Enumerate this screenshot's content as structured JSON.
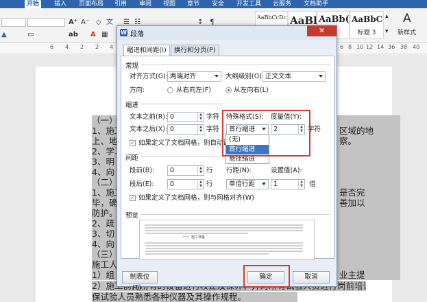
{
  "menubar": {
    "items": [
      "开始",
      "插入",
      "页面布局",
      "引用",
      "审阅",
      "视图",
      "章节",
      "安全",
      "开发工具",
      "云服务",
      "文档助手"
    ],
    "active_index": 0
  },
  "toolbar": {
    "style_samples": [
      {
        "sample": "AaBbCcDc",
        "label": ""
      },
      {
        "sample": "AaBl",
        "label": ""
      },
      {
        "sample": "AaBb(",
        "label": ""
      },
      {
        "sample": "AaBbC",
        "label": "标题 3"
      }
    ],
    "new_style_label": "新样式"
  },
  "ruler": {
    "numbers": [
      "6",
      "4",
      "2",
      "2",
      "4",
      "6",
      "8",
      "10",
      "12",
      "14",
      "36",
      "38",
      "40"
    ]
  },
  "document": {
    "left_lines": [
      "（一）",
      "1、施工",
      "上、地",
      "2、学习",
      "3、明",
      "4、向",
      "（二）",
      "1、施工",
      "毕，确",
      "防护。",
      "2、疏",
      "3、切",
      "4、向",
      "（三）",
      "施工人",
      "1）组",
      "2）施工前对所有的设备进行校正及保养，并对所有试验人员进行岗前培训，确",
      "保试验人员熟悉各种仪器及其操作规程。"
    ],
    "right_texts": [
      "区域的地",
      "察。",
      "是否完",
      "善加以",
      "业主提"
    ]
  },
  "dialog": {
    "title": "段落",
    "close_symbol": "✕",
    "tabs": [
      "缩进和间距(I)",
      "换行和分页(P)"
    ],
    "general": {
      "section_title": "常规",
      "align_label": "对齐方式(G):",
      "align_value": "两端对齐",
      "outline_label": "大纲级别(O):",
      "outline_value": "正文文本",
      "direction_label": "方向:",
      "rtl_label": "从右向左(F)",
      "ltr_label": "从左向右(L)"
    },
    "indent": {
      "section_title": "缩进",
      "before_label": "文本之前(R):",
      "before_value": "0",
      "before_unit": "字符",
      "after_label": "文本之后(X):",
      "after_value": "0",
      "after_unit": "字符",
      "special_label": "特殊格式(S):",
      "special_value": "首行缩进",
      "measure_label": "度量值(Y):",
      "measure_value": "2",
      "measure_unit": "字符",
      "auto_adjust_label": "如果定义了文档网格，则自动调整",
      "dropdown_options": [
        "(无)",
        "首行缩进",
        "悬挂缩进"
      ],
      "dropdown_selected": 1
    },
    "spacing": {
      "section_title": "间距",
      "before_label": "段前(B):",
      "before_value": "0",
      "before_unit": "行",
      "after_label": "段后(E):",
      "after_value": "0",
      "after_unit": "行",
      "line_label": "行距(N):",
      "line_value": "单倍行距",
      "setting_label": "设置值(A):",
      "setting_value": "1",
      "setting_unit": "倍",
      "grid_label": "如果定义了文档网格，则与网格对齐(W)"
    },
    "preview": {
      "section_title": "预览",
      "sample_text": "（一）施工准备"
    },
    "buttons": {
      "tabs_label": "制表位(T)...",
      "ok_label": "确定",
      "cancel_label": "取消"
    }
  },
  "colors": {
    "accent": "#2e63ad",
    "highlight_red": "#d63b33",
    "close_red": "#c9392e"
  }
}
